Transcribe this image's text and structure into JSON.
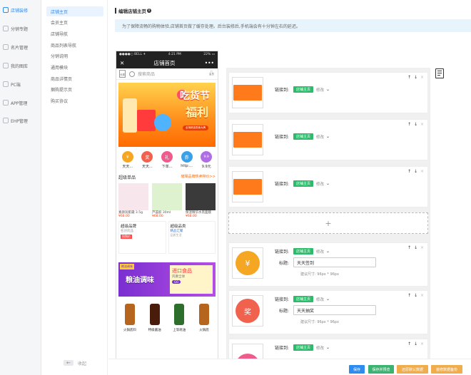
{
  "sidebar_primary": {
    "items": [
      {
        "label": "店铺装修",
        "icon": "store-icon",
        "active": true
      },
      {
        "label": "分销专题",
        "icon": "share-icon"
      },
      {
        "label": "名片管理",
        "icon": "card-icon"
      },
      {
        "label": "我的图库",
        "icon": "image-icon"
      },
      {
        "label": "PC端",
        "icon": "monitor-icon"
      },
      {
        "label": "APP管理",
        "icon": "app-icon"
      },
      {
        "label": "EHP管理",
        "icon": "settings-icon"
      }
    ]
  },
  "sidebar_secondary": {
    "items": [
      {
        "label": "店铺主页",
        "active": true
      },
      {
        "label": "会员主页"
      },
      {
        "label": "店铺导航"
      },
      {
        "label": "商品列表导航"
      },
      {
        "label": "分销说明"
      },
      {
        "label": "通用模块"
      },
      {
        "label": "商品详情页"
      },
      {
        "label": "捆购提示页"
      },
      {
        "label": "购买协议"
      }
    ],
    "collapse_label": "收起"
  },
  "page": {
    "title": "编辑店铺主页",
    "notice": "为了保障流畅的购物体验,店铺首页做了缓存处理。后台装修后,手机端会有十分钟左右的延迟。"
  },
  "phone": {
    "status": {
      "carrier": "●●●●○ BELL ✈",
      "time": "4:21 PM",
      "battery": "22% ▭"
    },
    "nav_title": "店铺首页",
    "search": {
      "category": "分类",
      "placeholder": "搜索商品",
      "me": "会员"
    },
    "banner": {
      "title_line1": "吃货节",
      "title_line2": "福利",
      "badge": "全场精选零食大牌"
    },
    "quick_icons": [
      {
        "label": "天天...",
        "glyph": "¥",
        "color": "#f5a623"
      },
      {
        "label": "天天...",
        "glyph": "奖",
        "color": "#f0624d"
      },
      {
        "label": "下单...",
        "glyph": "礼",
        "color": "#ef5b8a"
      },
      {
        "label": "http:...",
        "glyph": "券",
        "color": "#3aa0e8"
      },
      {
        "label": "9.9元",
        "glyph": "9.9",
        "color": "#b06ee6"
      }
    ],
    "super_items": {
      "title": "超级单品",
      "more": "璀璨品牌热卖特价>>",
      "products": [
        {
          "name": "素颜润肌霜 3.5g",
          "price": "¥68.00",
          "color": "#f4d7e0"
        },
        {
          "name": "芦荟胶 30ml",
          "price": "¥68.00",
          "color": "#9ad95a"
        },
        {
          "name": "保湿精华水黑面膜",
          "price": "¥68.00",
          "color": "#333333"
        }
      ]
    },
    "brand_box": {
      "title": "超级品牌",
      "caption": "名创优品",
      "badge": "抢购价"
    },
    "category_box": {
      "title": "超级品类",
      "caption": "精品汇聚",
      "sub": "品质生活"
    },
    "promo": {
      "label": "粮油调味",
      "title": "粮油调味",
      "right_title": "进口食品",
      "right_sub": "风靡全球",
      "go": "GO"
    },
    "bottles": [
      {
        "name": "火锅底料",
        "color": "#b5651d"
      },
      {
        "name": "特级酱油",
        "color": "#4a1c0c"
      },
      {
        "name": "上等耗油",
        "color": "#2d6e2d"
      },
      {
        "name": "火锅底",
        "color": "#b5651d"
      }
    ]
  },
  "modules": [
    {
      "type": "banner",
      "link_label": "链接到:",
      "link_tag": "店铺主页",
      "edit": "修改"
    },
    {
      "type": "banner",
      "link_label": "链接到:",
      "link_tag": "店铺主页",
      "edit": "修改"
    },
    {
      "type": "banner",
      "link_label": "链接到:",
      "link_tag": "店铺主页",
      "edit": "修改"
    },
    {
      "type": "add",
      "glyph": "+"
    },
    {
      "type": "icon",
      "link_label": "链接到:",
      "link_tag": "店铺主页",
      "edit": "修改",
      "title_label": "标题:",
      "title_value": "天天签到",
      "hint": "建议尺寸: 96px * 96px",
      "glyph": "¥",
      "color": "#f5a623"
    },
    {
      "type": "icon",
      "link_label": "链接到:",
      "link_tag": "店铺主页",
      "edit": "修改",
      "title_label": "标题:",
      "title_value": "天天抽奖",
      "hint": "建议尺寸: 96px * 96px",
      "glyph": "奖",
      "color": "#f0624d"
    },
    {
      "type": "icon",
      "link_label": "链接到:",
      "link_tag": "店铺主页",
      "edit": "修改",
      "color": "#ef5b8a"
    }
  ],
  "module_controls": {
    "up": "↑",
    "down": "↓",
    "close": "×"
  },
  "footer": {
    "save": "保存",
    "save_preview": "保存并预览",
    "restore": "还原默认数据",
    "backup": "装修数据备份"
  },
  "colors": {
    "accent": "#2d8cf0",
    "green_tag": "#2dba6b",
    "preview_btn": "#3cb371",
    "orange_btn": "#f0ad4e"
  }
}
